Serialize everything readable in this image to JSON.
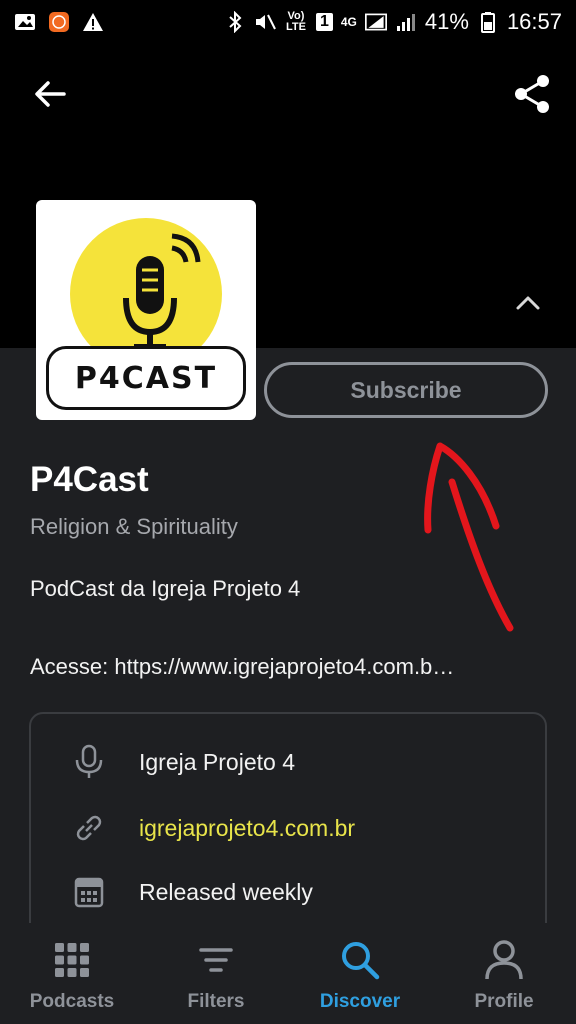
{
  "status_bar": {
    "battery_percent": "41%",
    "time": "16:57",
    "network": "4G",
    "volte": "Vo) LTE",
    "sim": "1"
  },
  "nav": {
    "back_icon": "arrow-left-icon",
    "share_icon": "share-icon",
    "collapse_icon": "chevron-up-icon"
  },
  "podcast": {
    "artwork_text": "P4CAST",
    "title": "P4Cast",
    "category": "Religion & Spirituality",
    "description_line1": "PodCast da Igreja Projeto 4",
    "description_line2": "Acesse: https://www.igrejaprojeto4.com.b…",
    "subscribe_label": "Subscribe"
  },
  "info": {
    "author": "Igreja Projeto 4",
    "website": "igrejaprojeto4.com.br",
    "schedule": "Released weekly"
  },
  "bottom_nav": [
    {
      "label": "Podcasts",
      "icon": "grid-icon",
      "active": false
    },
    {
      "label": "Filters",
      "icon": "filter-icon",
      "active": false
    },
    {
      "label": "Discover",
      "icon": "search-icon",
      "active": true
    },
    {
      "label": "Profile",
      "icon": "profile-icon",
      "active": false
    }
  ],
  "colors": {
    "background_top": "#000000",
    "background_content": "#1e1f22",
    "link": "#e8e44a",
    "active_tab": "#2f9fe0",
    "annotation": "#e3161c"
  }
}
